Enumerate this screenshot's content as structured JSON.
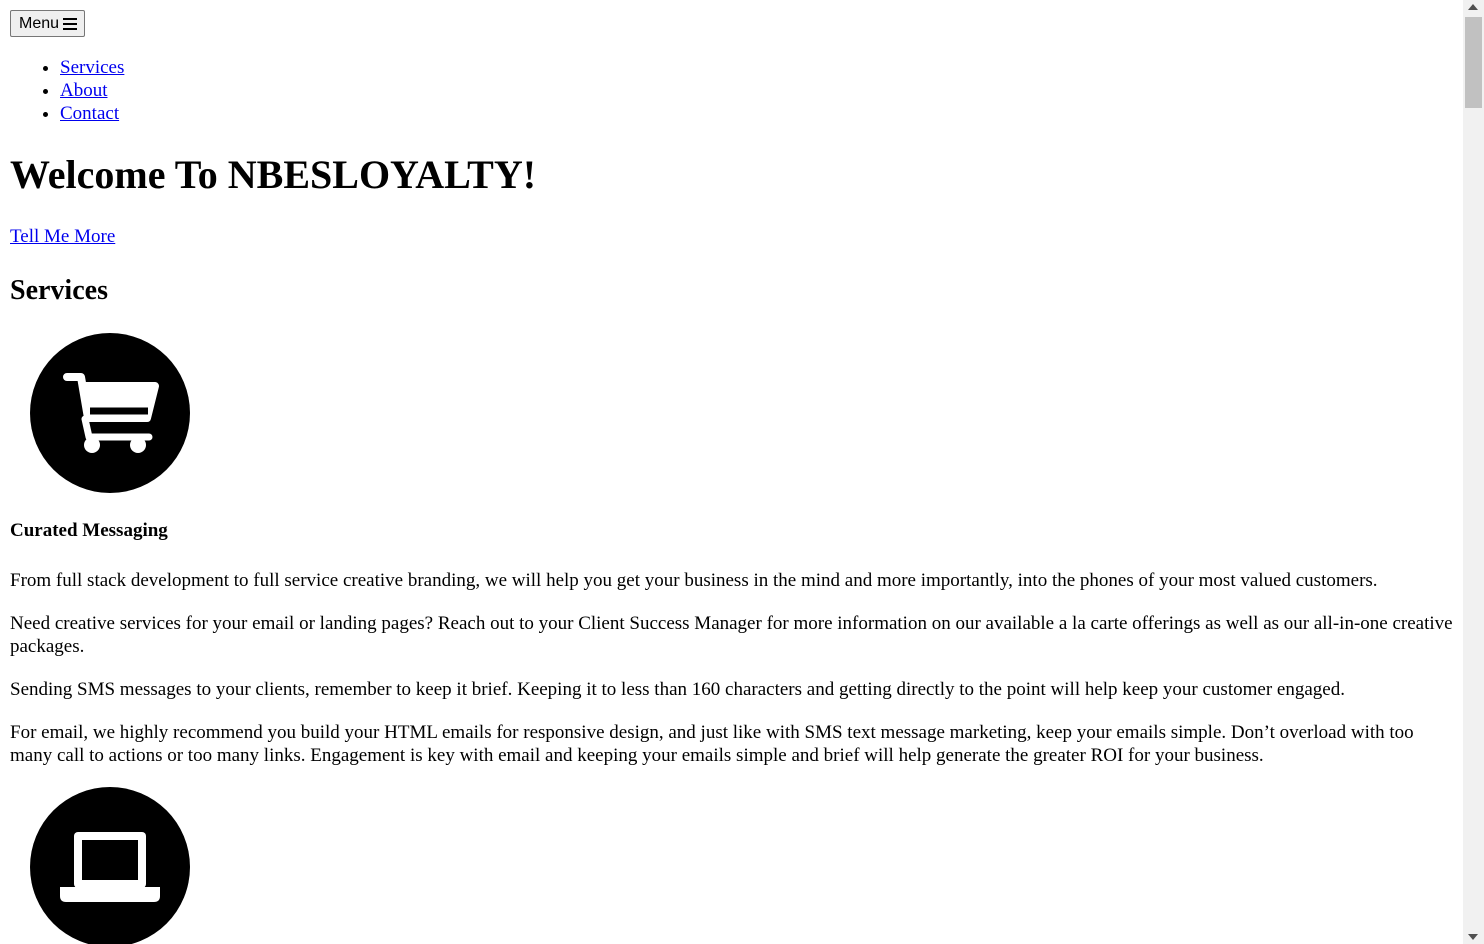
{
  "menu": {
    "label": "Menu",
    "icon": "hamburger-icon"
  },
  "nav": {
    "items": [
      {
        "label": "Services"
      },
      {
        "label": "About"
      },
      {
        "label": "Contact"
      }
    ]
  },
  "hero": {
    "title": "Welcome To NBESLOYALTY!",
    "cta_label": "Tell Me More"
  },
  "services": {
    "heading": "Services",
    "items": [
      {
        "icon": "shopping-cart-icon",
        "title": "Curated Messaging",
        "paragraphs": [
          "From full stack development to full service creative branding, we will help you get your business in the mind and more importantly, into the phones of your most valued customers.",
          "Need creative services for your email or landing pages? Reach out to your Client Success Manager for more information on our available a la carte offerings as well as our all-in-one creative packages.",
          "Sending SMS messages to your clients, remember to keep it brief. Keeping it to less than 160 characters and getting directly to the point will help keep your customer engaged.",
          "For email, we highly recommend you build your HTML emails for responsive design, and just like with SMS text message marketing, keep your emails simple. Don’t overload with too many call to actions or too many links. Engagement is key with email and keeping your emails simple and brief will help generate the greater ROI for your business."
        ]
      },
      {
        "icon": "laptop-icon"
      }
    ]
  },
  "colors": {
    "link": "#0000ee",
    "text": "#000000",
    "icon_circle": "#000000",
    "icon_glyph": "#ffffff"
  }
}
